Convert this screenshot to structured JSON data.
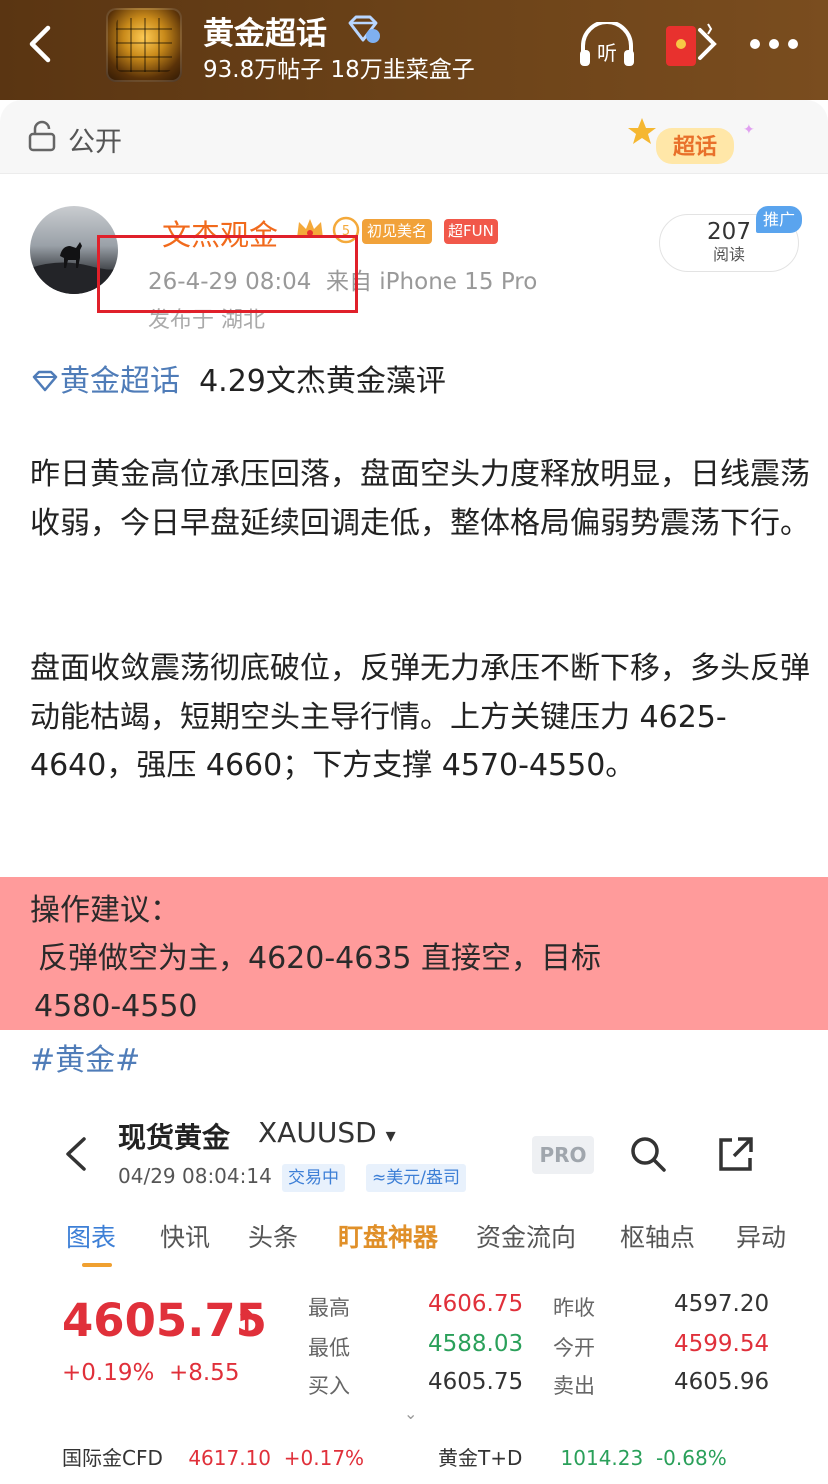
{
  "header": {
    "title": "黄金超话",
    "stats": "93.8万帖子 18万韭菜盒子",
    "listen_label": "听"
  },
  "visibility": {
    "label": "公开",
    "chaohua_sticker": "超话"
  },
  "post": {
    "username": "文杰观金",
    "level": "5",
    "badge_first": "初见美名",
    "badge_fun": "超FUN",
    "time": "26-4-29 08:04",
    "source": "来自 iPhone 15 Pro",
    "location": "发布于 湖北",
    "read_count": "207",
    "read_label": "阅读",
    "promo_label": "推广",
    "topic_tag": "黄金超话",
    "headline": "4.29文杰黄金藻评",
    "para1": "昨日黄金高位承压回落，盘面空头力度释放明显，日线震荡收弱，今日早盘延续回调走低，整体格局偏弱势震荡下行。",
    "para2": "盘面收敛震荡彻底破位，反弹无力承压不断下移，多头反弹动能枯竭，短期空头主导行情。上方关键压力 4625-4640，强压 4660；下方支撑 4570-4550。",
    "advice_title": "操作建议：",
    "advice_line1": "反弹做空为主，4620-4635 直接空，目标",
    "advice_line2": "4580-4550",
    "hashtag": "#黄金#"
  },
  "quote": {
    "name": "现货黄金",
    "code": "XAUUSD",
    "datetime": "04/29 08:04:14",
    "status": "交易中",
    "unit": "≈美元/盎司",
    "pro": "PRO",
    "tabs": [
      "图表",
      "快讯",
      "头条",
      "盯盘神器",
      "资金流向",
      "枢轴点",
      "异动"
    ],
    "price": "4605.75",
    "change_pct": "+0.19%",
    "change_abs": "+8.55",
    "high_label": "最高",
    "high": "4606.75",
    "low_label": "最低",
    "low": "4588.03",
    "bid_label": "买入",
    "bid": "4605.75",
    "prev_close_label": "昨收",
    "prev_close": "4597.20",
    "open_label": "今开",
    "open": "4599.54",
    "ask_label": "卖出",
    "ask": "4605.96",
    "related": [
      {
        "name": "国际金CFD",
        "value": "4617.10",
        "change": "+0.17%"
      },
      {
        "name": "黄金T+D",
        "value": "1014.23",
        "change": "-0.68%"
      }
    ]
  }
}
